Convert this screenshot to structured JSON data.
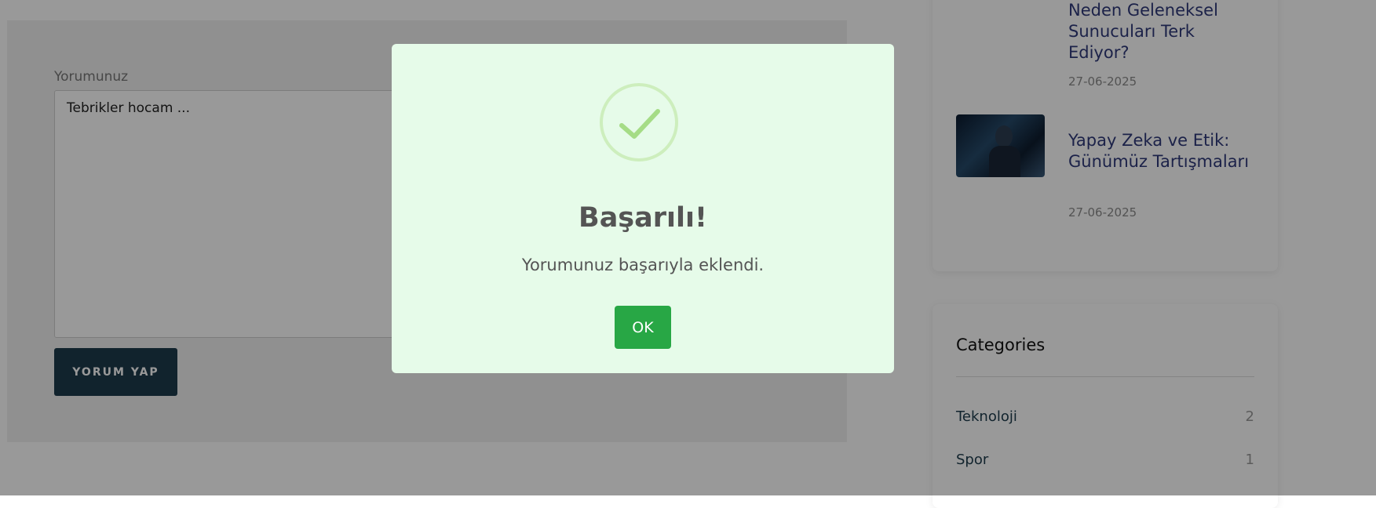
{
  "comment_form": {
    "label": "Yorumunuz",
    "textarea_value": "Tebrikler hocam ...",
    "submit_label": "YORUM YAP"
  },
  "recent_posts": [
    {
      "title": "Neden Geleneksel Sunucuları Terk Ediyor?",
      "date": "27-06-2025"
    },
    {
      "title": "Yapay Zeka ve Etik: Günümüz Tartışmaları",
      "date": "27-06-2025"
    }
  ],
  "categories": {
    "heading": "Categories",
    "items": [
      {
        "name": "Teknoloji",
        "count": "2"
      },
      {
        "name": "Spor",
        "count": "1"
      }
    ]
  },
  "modal": {
    "icon": "success-check-icon",
    "title": "Başarılı!",
    "message": "Yorumunuz başarıyla eklendi.",
    "ok_label": "OK",
    "colors": {
      "background": "#e6fbe9",
      "ok_button": "#28a745",
      "check": "#a5dc86"
    }
  }
}
